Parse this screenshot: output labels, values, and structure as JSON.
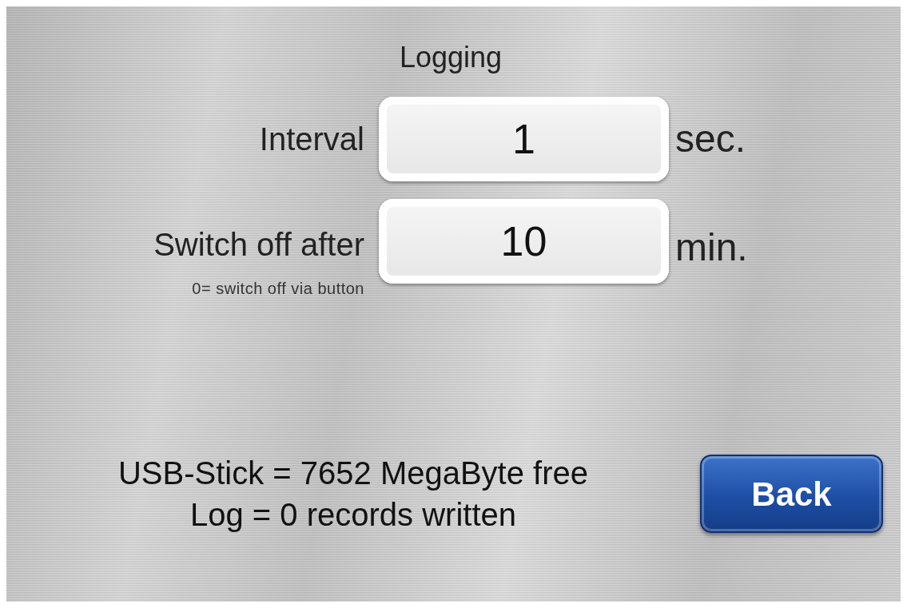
{
  "title": "Logging",
  "fields": [
    {
      "label": "Interval",
      "value": "1",
      "unit": "sec."
    },
    {
      "label": "Switch off after",
      "value": "10",
      "unit": "min.",
      "hint": "0= switch off via button"
    }
  ],
  "status_lines": [
    "USB-Stick = 7652 MegaByte free",
    "Log = 0 records written"
  ],
  "buttons": [
    {
      "label": "Back"
    }
  ]
}
